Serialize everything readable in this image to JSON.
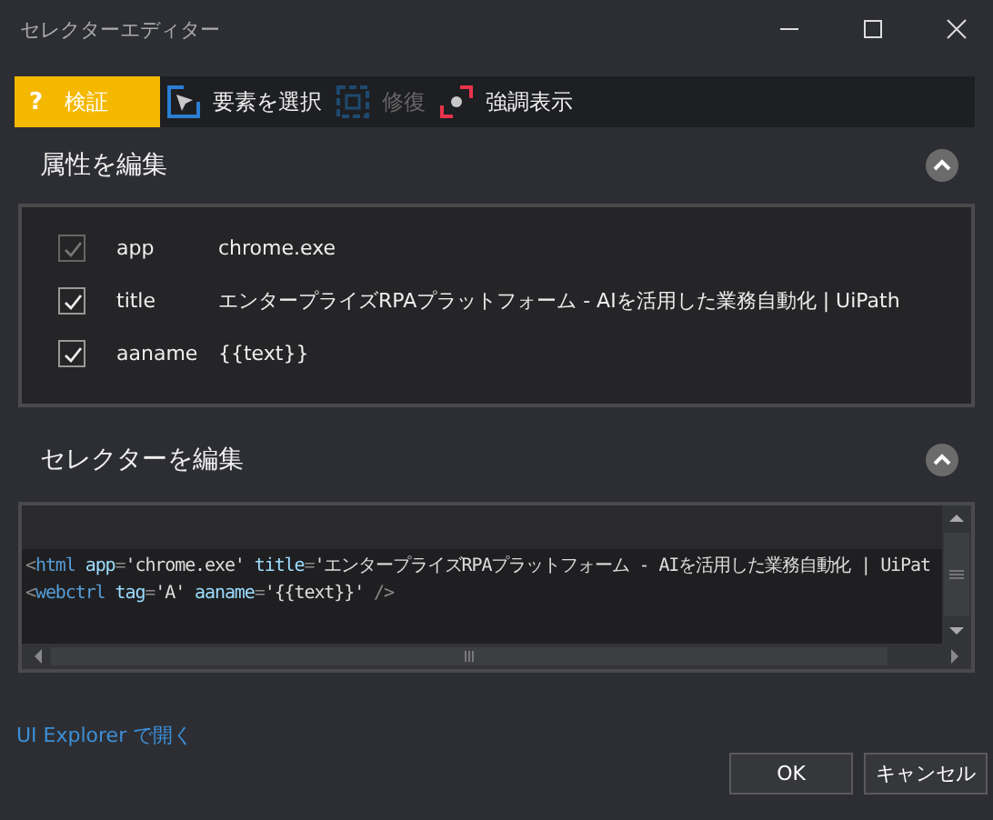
{
  "window": {
    "title": "セレクターエディター"
  },
  "toolbar": [
    {
      "kind": "validate",
      "icon": "?",
      "label": "検証",
      "disabled": false
    },
    {
      "kind": "pick",
      "label": "要素を選択",
      "disabled": false
    },
    {
      "kind": "repair",
      "label": "修復",
      "disabled": true
    },
    {
      "kind": "highlight",
      "label": "強調表示",
      "disabled": false
    }
  ],
  "attributes_section": {
    "title": "属性を編集",
    "expanded": true,
    "rows": [
      {
        "name": "app",
        "value": "chrome.exe",
        "checked": true,
        "disabled": true
      },
      {
        "name": "title",
        "value": "エンタープライズRPAプラットフォーム - AIを活用した業務自動化 | UiPath",
        "checked": true,
        "disabled": false
      },
      {
        "name": "aaname",
        "value": "{{text}}",
        "checked": true,
        "disabled": false
      }
    ]
  },
  "selector_section": {
    "title": "セレクターを編集",
    "expanded": true,
    "lines": [
      [
        {
          "kind": "punct",
          "text": "<"
        },
        {
          "kind": "tag",
          "text": "html"
        },
        {
          "kind": "attr",
          "text": " app"
        },
        {
          "kind": "punct",
          "text": "="
        },
        {
          "kind": "value",
          "text": "'chrome.exe'"
        },
        {
          "kind": "attr",
          "text": " title"
        },
        {
          "kind": "punct",
          "text": "="
        },
        {
          "kind": "value",
          "text": "'エンタープライズRPAプラットフォーム - AIを活用した業務自動化 | UiPat"
        }
      ],
      [
        {
          "kind": "punct",
          "text": "<"
        },
        {
          "kind": "tag",
          "text": "webctrl"
        },
        {
          "kind": "attr",
          "text": " tag"
        },
        {
          "kind": "punct",
          "text": "="
        },
        {
          "kind": "value",
          "text": "'A'"
        },
        {
          "kind": "attr",
          "text": " aaname"
        },
        {
          "kind": "punct",
          "text": "="
        },
        {
          "kind": "value",
          "text": "'{{text}}'"
        },
        {
          "kind": "punct",
          "text": " />"
        }
      ]
    ]
  },
  "link": "UI Explorer で開く",
  "buttons": [
    "OK",
    "キャンセル"
  ]
}
